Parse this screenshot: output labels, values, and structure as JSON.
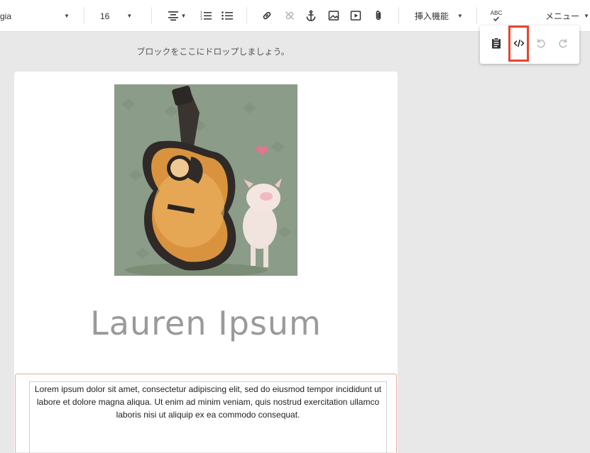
{
  "toolbar": {
    "font_family": "gia",
    "font_size": "16",
    "insert_label": "挿入機能",
    "spellcheck_label": "ABC",
    "menu_label": "メニュー"
  },
  "icons": [
    "chevron-down-icon",
    "align-center-icon",
    "ordered-list-icon",
    "bullet-list-icon",
    "link-icon",
    "unlink-icon",
    "anchor-icon",
    "image-icon",
    "video-icon",
    "attachment-icon",
    "spellcheck-icon",
    "clipboard-icon",
    "code-view-icon",
    "undo-icon",
    "redo-icon"
  ],
  "colors": {
    "highlight": "#e8432e",
    "title": "#9a9a9a",
    "photo_bg": "#8a9b87"
  },
  "canvas": {
    "drop_hint": "ブロックをここにドロップしましょう。",
    "title": "Lauren Ipsum",
    "body_text": "Lorem ipsum dolor sit amet, consectetur adipiscing elit, sed do eiusmod tempor incididunt ut labore et dolore magna aliqua. Ut enim ad minim veniam, quis nostrud exercitation ullamco laboris nisi ut aliquip ex ea commodo consequat."
  }
}
